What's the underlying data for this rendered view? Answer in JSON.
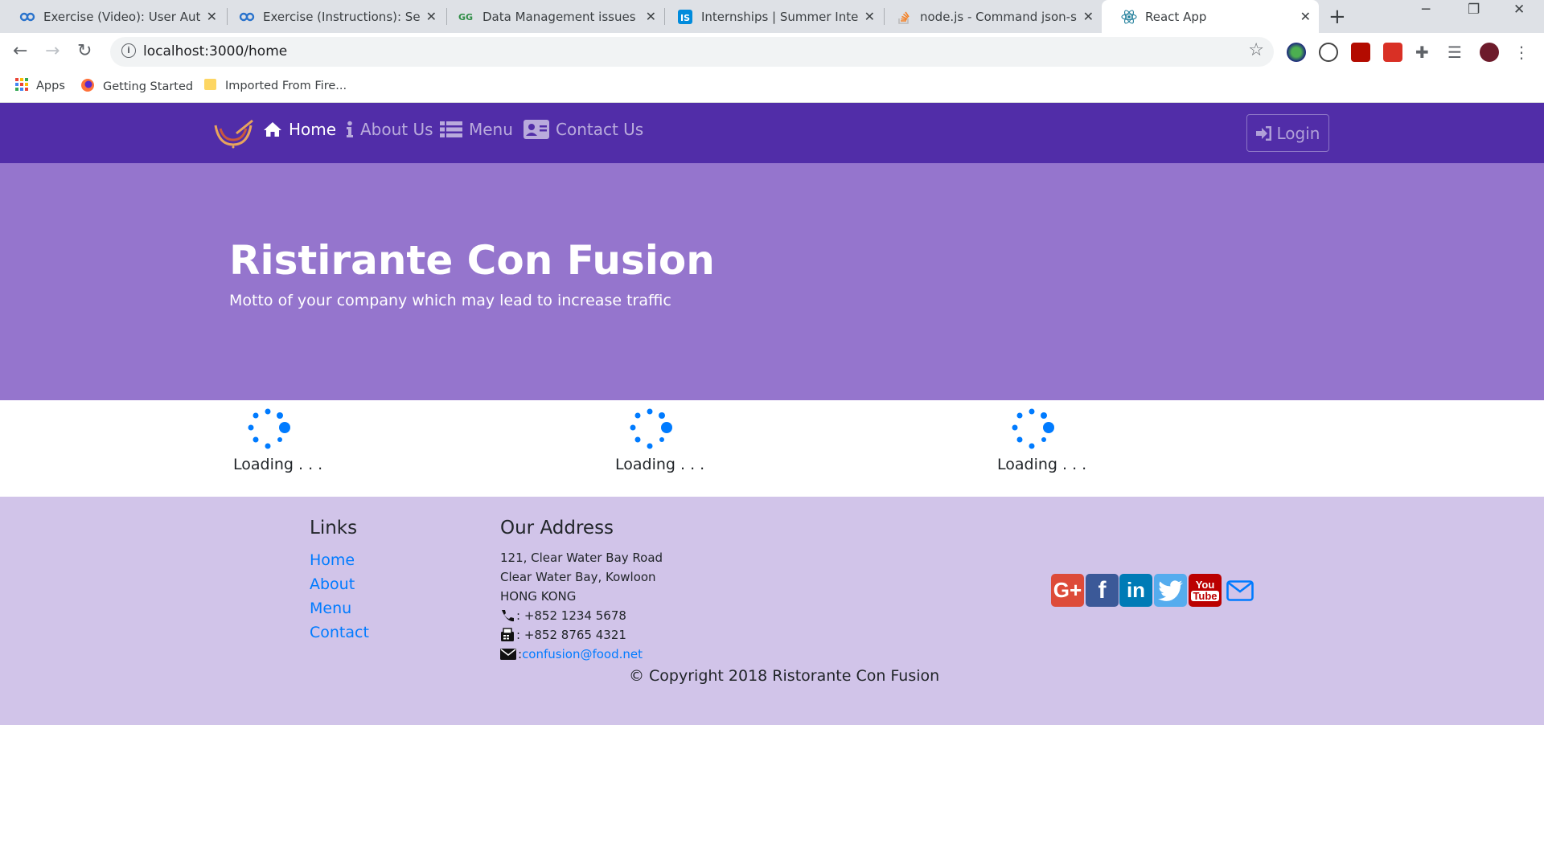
{
  "browser": {
    "tabs": [
      {
        "title": "Exercise (Video): User Authentication",
        "icon": "coursera-icon"
      },
      {
        "title": "Exercise (Instructions): Setting up",
        "icon": "coursera-icon"
      },
      {
        "title": "Data Management issues in React",
        "icon": "geeksforgeeks-icon"
      },
      {
        "title": "Internships | Summer Internships",
        "icon": "internshala-icon"
      },
      {
        "title": "node.js - Command json-server",
        "icon": "stackoverflow-icon"
      },
      {
        "title": "React App",
        "icon": "react-icon"
      }
    ],
    "address": "localhost:3000/home",
    "bookmarks": [
      {
        "label": "Apps",
        "icon": "apps-grid-icon"
      },
      {
        "label": "Getting Started",
        "icon": "firefox-icon"
      },
      {
        "label": "Imported From Fire...",
        "icon": "folder-icon"
      }
    ]
  },
  "navbar": {
    "links": [
      {
        "label": "Home",
        "icon": "home-icon",
        "active": true
      },
      {
        "label": "About Us",
        "icon": "info-icon",
        "active": false
      },
      {
        "label": "Menu",
        "icon": "list-icon",
        "active": false
      },
      {
        "label": "Contact Us",
        "icon": "address-card-icon",
        "active": false
      }
    ],
    "login_label": "Login",
    "colors": {
      "bg": "#512da8"
    }
  },
  "jumbotron": {
    "title": "Ristirante Con Fusion",
    "motto": "Motto of your company which may lead to increase traffic",
    "colors": {
      "bg": "#9575cd"
    }
  },
  "loaders": [
    {
      "text": "Loading . . ."
    },
    {
      "text": "Loading . . ."
    },
    {
      "text": "Loading . . ."
    }
  ],
  "footer": {
    "links_heading": "Links",
    "links": [
      "Home",
      "About",
      "Menu",
      "Contact"
    ],
    "address_heading": "Our Address",
    "address_lines": [
      "121, Clear Water Bay Road",
      "Clear Water Bay, Kowloon",
      "HONG KONG"
    ],
    "phone": ": +852 1234 5678",
    "fax": ": +852 8765 4321",
    "email_prefix": ": ",
    "email": "confusion@food.net",
    "social": [
      {
        "name": "google-plus-icon",
        "color": "#dd4b39",
        "glyph": "G+"
      },
      {
        "name": "facebook-icon",
        "color": "#3b5998",
        "glyph": "f"
      },
      {
        "name": "linkedin-icon",
        "color": "#007bb6",
        "glyph": "in"
      },
      {
        "name": "twitter-icon",
        "color": "#55acee",
        "glyph": "🐦"
      },
      {
        "name": "youtube-icon",
        "color": "#bb0000",
        "glyph": "You\nTube"
      }
    ],
    "copyright": "© Copyright 2018 Ristorante Con Fusion",
    "colors": {
      "bg": "#d1c4e9",
      "link": "#007bff"
    }
  }
}
